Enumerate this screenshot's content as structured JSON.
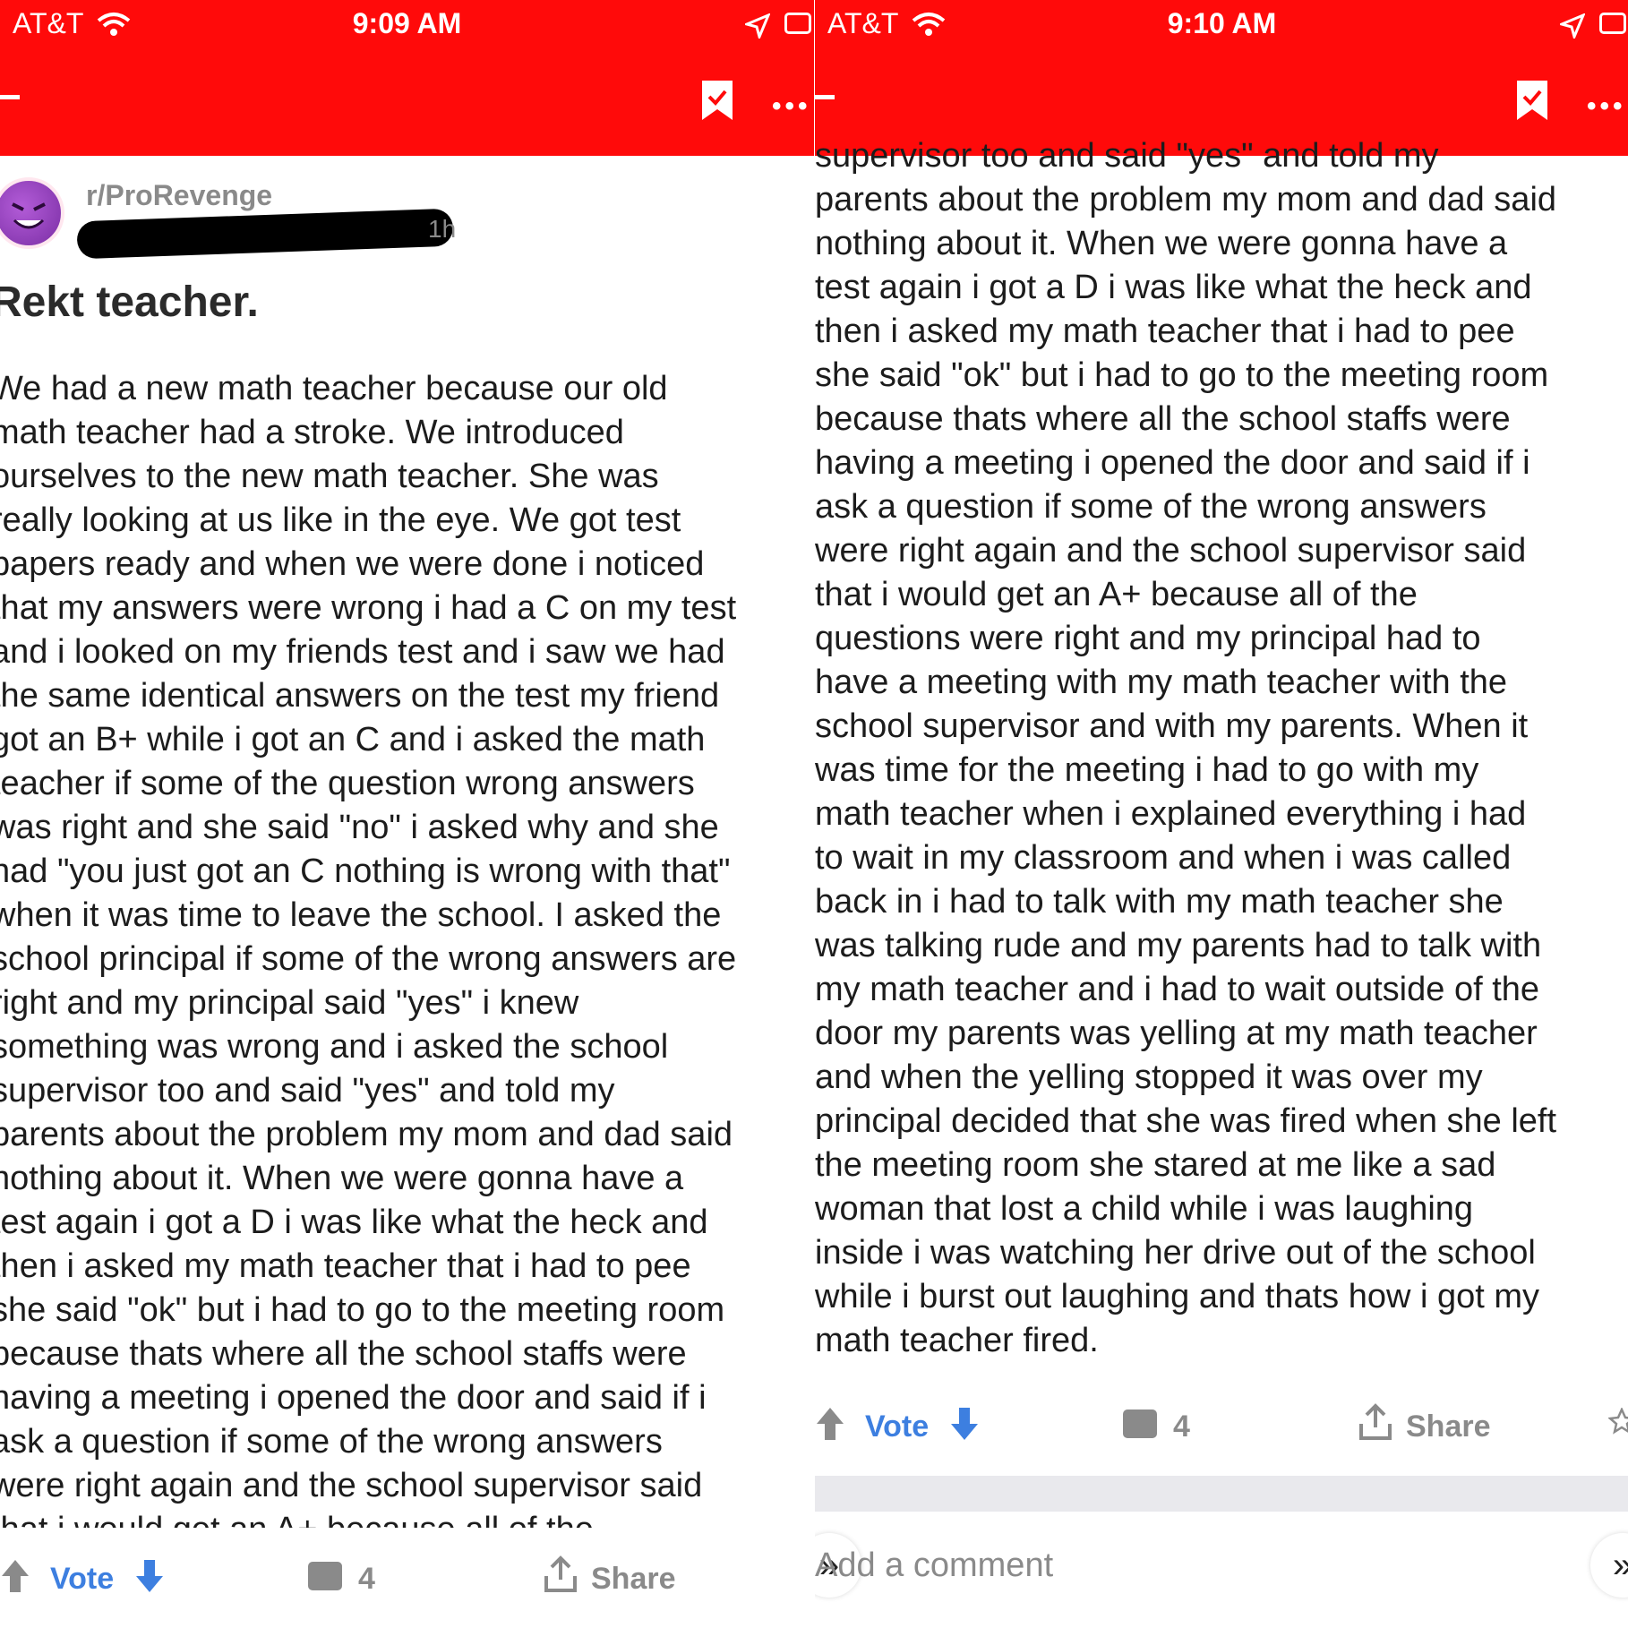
{
  "left": {
    "status": {
      "carrier": "AT&T",
      "time": "9:09 AM"
    },
    "subreddit": "r/ProRevenge",
    "post_age": "1h",
    "title": "Rekt teacher.",
    "lines": [
      "We had a new math teacher because our old",
      "math teacher had a stroke. We introduced",
      "ourselves to the new math teacher. She was",
      "really looking at us like in the eye. We got test",
      "papers ready and when we were done i noticed",
      "that my answers were wrong i had a C on my test",
      "and i looked on my friends test and i saw we had",
      "the same identical answers on the test my friend",
      "got an B+ while i got an C and i asked the math",
      "teacher if some of the question wrong answers",
      "was right and she said \"no\" i asked why and she",
      "had \"you just got an C nothing is wrong with that\"",
      "when it was time to leave the school. I asked the",
      "school principal if some of the wrong answers are",
      "right and my principal said \"yes\" i knew",
      "something was wrong and i asked the school",
      "supervisor too and said \"yes\" and told my",
      "parents about the problem my mom and dad said",
      "nothing about it. When  we were gonna have a",
      "test again i got a D i was like what the heck and",
      "then i asked my math teacher that i had to pee",
      "she said \"ok\" but i had to go to the meeting room",
      "because thats where all the school staffs were",
      "having a meeting i opened the door and said if i",
      "ask a question if some of the wrong answers",
      "were right again and the school supervisor said",
      "that i would get an A+ because all of the"
    ],
    "actions": {
      "vote": "Vote",
      "comments": "4",
      "share": "Share"
    }
  },
  "right": {
    "status": {
      "carrier": "AT&T",
      "time": "9:10 AM"
    },
    "lines": [
      "supervisor too and said \"yes\" and told my",
      "parents about the problem my mom and dad said",
      "nothing about it. When  we were gonna have a",
      "test again i got a D i was like what the heck and",
      "then i asked my math teacher that i had to pee",
      "she said \"ok\" but i had to go to the meeting room",
      "because thats where all the school staffs were",
      "having a meeting i opened the door and said if i",
      "ask a question if some of the wrong answers",
      "were right again and the school supervisor said",
      "that i would get an A+ because all of the",
      "questions were right and my principal had to",
      "have a meeting with my math teacher with the",
      "school supervisor and with my parents. When it",
      "was time for the meeting i had to go with my",
      "math teacher when i explained everything i had",
      "to wait in my classroom and when i was called",
      "back in i had to talk with my math teacher she",
      "was talking rude and my parents had to talk with",
      "my math teacher and i had to wait outside of the",
      "door my parents was yelling at my math teacher",
      "and when the yelling stopped it was over my",
      "principal decided that she was fired when she left",
      "the meeting room she stared at me like a sad",
      "woman that lost a child while i was laughing",
      "inside i was watching her drive out of the school",
      "while i burst out laughing and thats how i got my",
      "math teacher fired."
    ],
    "actions": {
      "vote": "Vote",
      "comments": "4",
      "share": "Share"
    },
    "comment_placeholder": "Add a comment"
  },
  "icons": {
    "wifi": "wifi-icon",
    "location": "location-arrow-icon",
    "battery": "battery-icon",
    "back": "back-arrow-icon",
    "bookmark": "bookmark-check-icon",
    "more": "more-dots-icon",
    "upvote": "upvote-arrow-icon",
    "downvote": "downvote-arrow-icon",
    "comment": "comment-bubble-icon",
    "share": "share-icon",
    "award": "award-icon",
    "collapse": "collapse-chevron-icon"
  },
  "colors": {
    "toolbar": "#ff0a0a",
    "vote_blue": "#3d7fe0",
    "gray": "#8a8a8a"
  }
}
